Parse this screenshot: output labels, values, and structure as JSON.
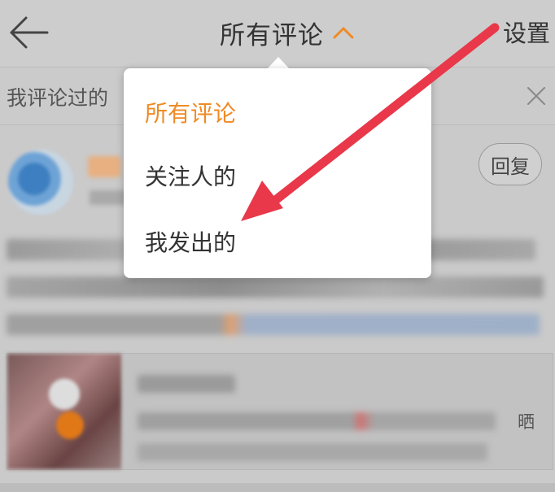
{
  "header": {
    "title": "所有评论",
    "settings_label": "设置",
    "back_icon": "back-arrow-icon",
    "caret_icon": "chevron-up-icon"
  },
  "search": {
    "text": "我评论过的",
    "clear_icon": "close-icon"
  },
  "dropdown": {
    "items": [
      {
        "label": "所有评论",
        "selected": true
      },
      {
        "label": "关注人的",
        "selected": false
      },
      {
        "label": "我发出的",
        "selected": false
      }
    ]
  },
  "comment": {
    "reply_label": "回复"
  },
  "shared_card": {
    "tail_text": "晒"
  },
  "colors": {
    "accent": "#f08a24",
    "annotation_arrow": "#e8384a",
    "text": "#333333"
  }
}
